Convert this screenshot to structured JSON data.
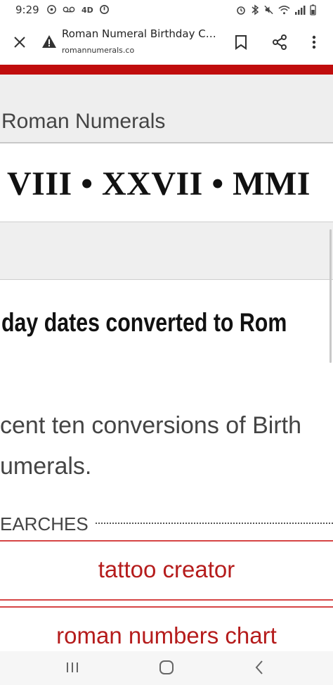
{
  "status_bar": {
    "time": "9:29",
    "left_icons": [
      "whatsapp-icon",
      "voicemail-icon",
      "4d-icon",
      "vpn-icon"
    ],
    "right_icons": [
      "alarm-icon",
      "bluetooth-icon",
      "mute-icon",
      "wifi-icon",
      "signal-icon",
      "battery-icon"
    ]
  },
  "browser": {
    "page_title": "Roman Numeral Birthday Con...",
    "url": "romannumerals.co",
    "icons": [
      "close-icon",
      "warning-icon",
      "bookmark-icon",
      "share-icon",
      "more-vert-icon"
    ]
  },
  "colors": {
    "accent_red": "#c00d0d",
    "link_red": "#b51c1c"
  },
  "page": {
    "site_title": "Roman Numerals",
    "numeral_date": "VIII • XXVII • MMI",
    "heading": "day dates converted to Rom",
    "description": "cent ten conversions of Birth\numerals.",
    "searches_label": "EARCHES",
    "links": [
      {
        "label": "tattoo creator"
      },
      {
        "label": "roman numbers chart"
      }
    ]
  },
  "nav_bar": {
    "icons": [
      "recents-icon",
      "home-icon",
      "back-icon"
    ]
  }
}
